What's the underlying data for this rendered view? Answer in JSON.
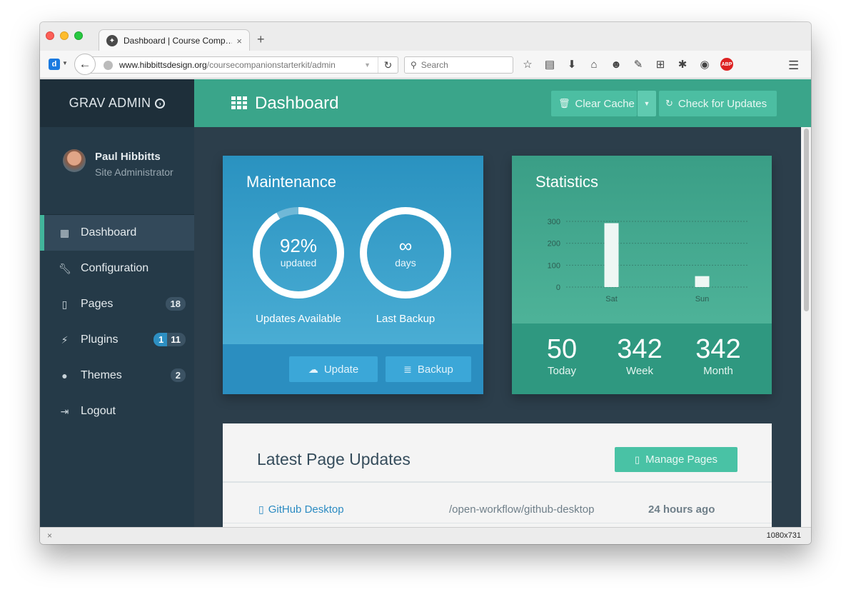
{
  "browser": {
    "tab_title": "Dashboard | Course Comp…",
    "tab_close": "×",
    "new_tab": "+",
    "url_host": "www.hibbittsdesign.org",
    "url_path": "/coursecompanionstarterkit/admin",
    "search_placeholder": "Search",
    "status_left": "×",
    "status_size": "1080x731"
  },
  "sidebar": {
    "brand": "GRAV ADMIN",
    "brand_icon": "arrow-circle-right-icon",
    "user_name": "Paul Hibbitts",
    "user_role": "Site Administrator",
    "items": [
      {
        "label": "Dashboard",
        "icon": "grid-icon",
        "active": true
      },
      {
        "label": "Configuration",
        "icon": "wrench-icon"
      },
      {
        "label": "Pages",
        "icon": "file-icon",
        "badge": "18"
      },
      {
        "label": "Plugins",
        "icon": "plug-icon",
        "badge_a": "1",
        "badge_b": "11"
      },
      {
        "label": "Themes",
        "icon": "drop-icon",
        "badge": "2"
      },
      {
        "label": "Logout",
        "icon": "sign-out-icon"
      }
    ]
  },
  "header": {
    "title": "Dashboard",
    "clear_cache": "Clear Cache",
    "check_updates": "Check for Updates"
  },
  "maintenance": {
    "title": "Maintenance",
    "updates_percent": 92,
    "updates_value": "92%",
    "updates_sub": "updated",
    "updates_caption": "Updates Available",
    "backup_value": "∞",
    "backup_sub": "days",
    "backup_caption": "Last Backup",
    "update_btn": "Update",
    "backup_btn": "Backup"
  },
  "statistics": {
    "title": "Statistics",
    "today_value": "50",
    "today_label": "Today",
    "week_value": "342",
    "week_label": "Week",
    "month_value": "342",
    "month_label": "Month"
  },
  "chart_data": {
    "type": "bar",
    "categories": [
      "Sat",
      "Sun"
    ],
    "values": [
      292,
      50
    ],
    "yticks": [
      0,
      100,
      200,
      300
    ],
    "ylim": [
      0,
      300
    ],
    "grid": true
  },
  "pages": {
    "title": "Latest Page Updates",
    "manage_btn": "Manage Pages",
    "rows": [
      {
        "title": "GitHub Desktop",
        "route": "/open-workflow/github-desktop",
        "time": "24 hours ago"
      }
    ]
  },
  "colors": {
    "sidebar": "#253a48",
    "header": "#3aa58a",
    "maintenance": "#2a92c0",
    "statistics": "#3a9e86",
    "accent": "#41b59b"
  }
}
